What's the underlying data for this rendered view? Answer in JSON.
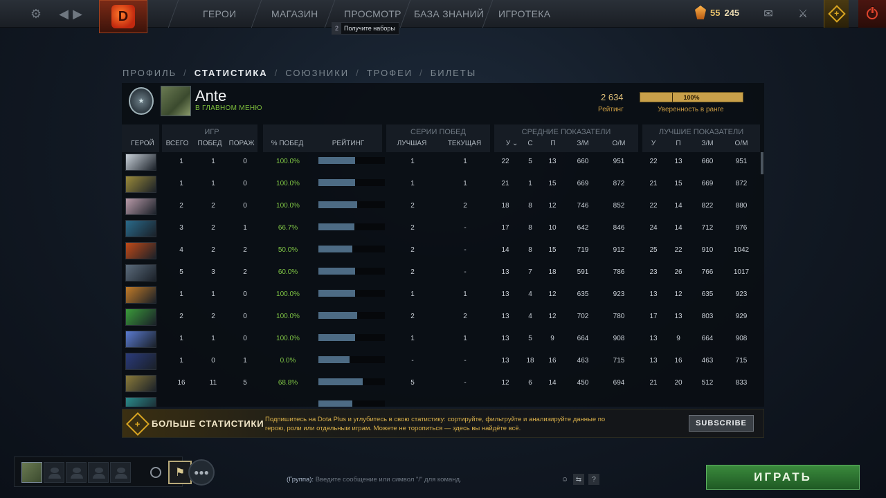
{
  "topbar": {
    "nav": [
      "ГЕРОИ",
      "МАГАЗИН",
      "ПРОСМОТР",
      "БАЗА ЗНАНИЙ",
      "ИГРОТЕКА"
    ],
    "tooltip_num": "2",
    "tooltip_text": "Получите наборы",
    "shards": "55",
    "shards2": "245"
  },
  "crumbs": [
    "ПРОФИЛЬ",
    "СТАТИСТИКА",
    "СОЮЗНИКИ",
    "ТРОФЕИ",
    "БИЛЕТЫ"
  ],
  "profile": {
    "name": "Ante",
    "status": "В ГЛАВНОМ МЕНЮ",
    "rating": "2 634",
    "rating_label": "Рейтинг",
    "confidence": "100%",
    "confidence_value": 1.0,
    "confidence_label": "Уверенность в ранге"
  },
  "table": {
    "groups": {
      "games": "ИГР",
      "streaks": "СЕРИИ ПОБЕД",
      "avg": "СРЕДНИЕ ПОКАЗАТЕЛИ",
      "best": "ЛУЧШИЕ ПОКАЗАТЕЛИ"
    },
    "cols": {
      "hero": "ГЕРОЙ",
      "total": "ВСЕГО",
      "wins": "ПОБЕД",
      "losses": "ПОРАЖ",
      "winrate": "% ПОБЕД",
      "rating": "РЕЙТИНГ",
      "best_streak": "ЛУЧШАЯ",
      "current_streak": "ТЕКУЩАЯ",
      "k": "У",
      "d": "С",
      "a": "П",
      "gpm": "З/М",
      "xpm": "О/М"
    },
    "rows": [
      {
        "total": "1",
        "wins": "1",
        "losses": "0",
        "winrate": "100.0%",
        "rating": 0.55,
        "best": "1",
        "cur": "1",
        "k": "22",
        "d": "5",
        "a": "13",
        "gpm": "660",
        "xpm": "951",
        "bk": "22",
        "ba": "13",
        "bgpm": "660",
        "bxpm": "951",
        "hero_color": "#c8d0d8"
      },
      {
        "total": "1",
        "wins": "1",
        "losses": "0",
        "winrate": "100.0%",
        "rating": 0.55,
        "best": "1",
        "cur": "1",
        "k": "21",
        "d": "1",
        "a": "15",
        "gpm": "669",
        "xpm": "872",
        "bk": "21",
        "ba": "15",
        "bgpm": "669",
        "bxpm": "872",
        "hero_color": "#9a8a3a"
      },
      {
        "total": "2",
        "wins": "2",
        "losses": "0",
        "winrate": "100.0%",
        "rating": 0.58,
        "best": "2",
        "cur": "2",
        "k": "18",
        "d": "8",
        "a": "12",
        "gpm": "746",
        "xpm": "852",
        "bk": "22",
        "ba": "14",
        "bgpm": "822",
        "bxpm": "880",
        "hero_color": "#b89aa8"
      },
      {
        "total": "3",
        "wins": "2",
        "losses": "1",
        "winrate": "66.7%",
        "rating": 0.54,
        "best": "2",
        "cur": "-",
        "k": "17",
        "d": "8",
        "a": "10",
        "gpm": "642",
        "xpm": "846",
        "bk": "24",
        "ba": "14",
        "bgpm": "712",
        "bxpm": "976",
        "hero_color": "#2a6a8a"
      },
      {
        "total": "4",
        "wins": "2",
        "losses": "2",
        "winrate": "50.0%",
        "rating": 0.51,
        "best": "2",
        "cur": "-",
        "k": "14",
        "d": "8",
        "a": "15",
        "gpm": "719",
        "xpm": "912",
        "bk": "25",
        "ba": "22",
        "bgpm": "910",
        "bxpm": "1042",
        "hero_color": "#c04a18"
      },
      {
        "total": "5",
        "wins": "3",
        "losses": "2",
        "winrate": "60.0%",
        "rating": 0.55,
        "best": "2",
        "cur": "-",
        "k": "13",
        "d": "7",
        "a": "18",
        "gpm": "591",
        "xpm": "786",
        "bk": "23",
        "ba": "26",
        "bgpm": "766",
        "bxpm": "1017",
        "hero_color": "#5a6a7a"
      },
      {
        "total": "1",
        "wins": "1",
        "losses": "0",
        "winrate": "100.0%",
        "rating": 0.55,
        "best": "1",
        "cur": "1",
        "k": "13",
        "d": "4",
        "a": "12",
        "gpm": "635",
        "xpm": "923",
        "bk": "13",
        "ba": "12",
        "bgpm": "635",
        "bxpm": "923",
        "hero_color": "#c07a28"
      },
      {
        "total": "2",
        "wins": "2",
        "losses": "0",
        "winrate": "100.0%",
        "rating": 0.58,
        "best": "2",
        "cur": "2",
        "k": "13",
        "d": "4",
        "a": "12",
        "gpm": "702",
        "xpm": "780",
        "bk": "17",
        "ba": "13",
        "bgpm": "803",
        "bxpm": "929",
        "hero_color": "#3a9a3a"
      },
      {
        "total": "1",
        "wins": "1",
        "losses": "0",
        "winrate": "100.0%",
        "rating": 0.55,
        "best": "1",
        "cur": "1",
        "k": "13",
        "d": "5",
        "a": "9",
        "gpm": "664",
        "xpm": "908",
        "bk": "13",
        "ba": "9",
        "bgpm": "664",
        "bxpm": "908",
        "hero_color": "#5a7ad0"
      },
      {
        "total": "1",
        "wins": "0",
        "losses": "1",
        "winrate": "0.0%",
        "rating": 0.47,
        "best": "-",
        "cur": "-",
        "k": "13",
        "d": "18",
        "a": "16",
        "gpm": "463",
        "xpm": "715",
        "bk": "13",
        "ba": "16",
        "bgpm": "463",
        "bxpm": "715",
        "hero_color": "#2a3a7a"
      },
      {
        "total": "16",
        "wins": "11",
        "losses": "5",
        "winrate": "68.8%",
        "rating": 0.67,
        "best": "5",
        "cur": "-",
        "k": "12",
        "d": "6",
        "a": "14",
        "gpm": "450",
        "xpm": "694",
        "bk": "21",
        "ba": "20",
        "bgpm": "512",
        "bxpm": "833",
        "hero_color": "#8a7a3a"
      },
      {
        "total": "",
        "wins": "",
        "losses": "",
        "winrate": "",
        "rating": 0.51,
        "best": "",
        "cur": "",
        "k": "",
        "d": "",
        "a": "",
        "gpm": "",
        "xpm": "",
        "bk": "",
        "ba": "",
        "bgpm": "",
        "bxpm": "",
        "hero_color": "#2a8a8a"
      }
    ]
  },
  "promo": {
    "title": "БОЛЬШЕ СТАТИСТИКИ",
    "text": "Подпишитесь на Dota Plus и углубитесь в свою статистику: сортируйте, фильтруйте и анализируйте данные по герою, роли или отдельным играм. Можете не торопиться — здесь вы найдёте всё.",
    "button": "SUBSCRIBE"
  },
  "bottom": {
    "chat_channel": "(Группа):",
    "chat_placeholder": "Введите сообщение или символ \"/\" для команд.",
    "play": "ИГРАТЬ"
  }
}
